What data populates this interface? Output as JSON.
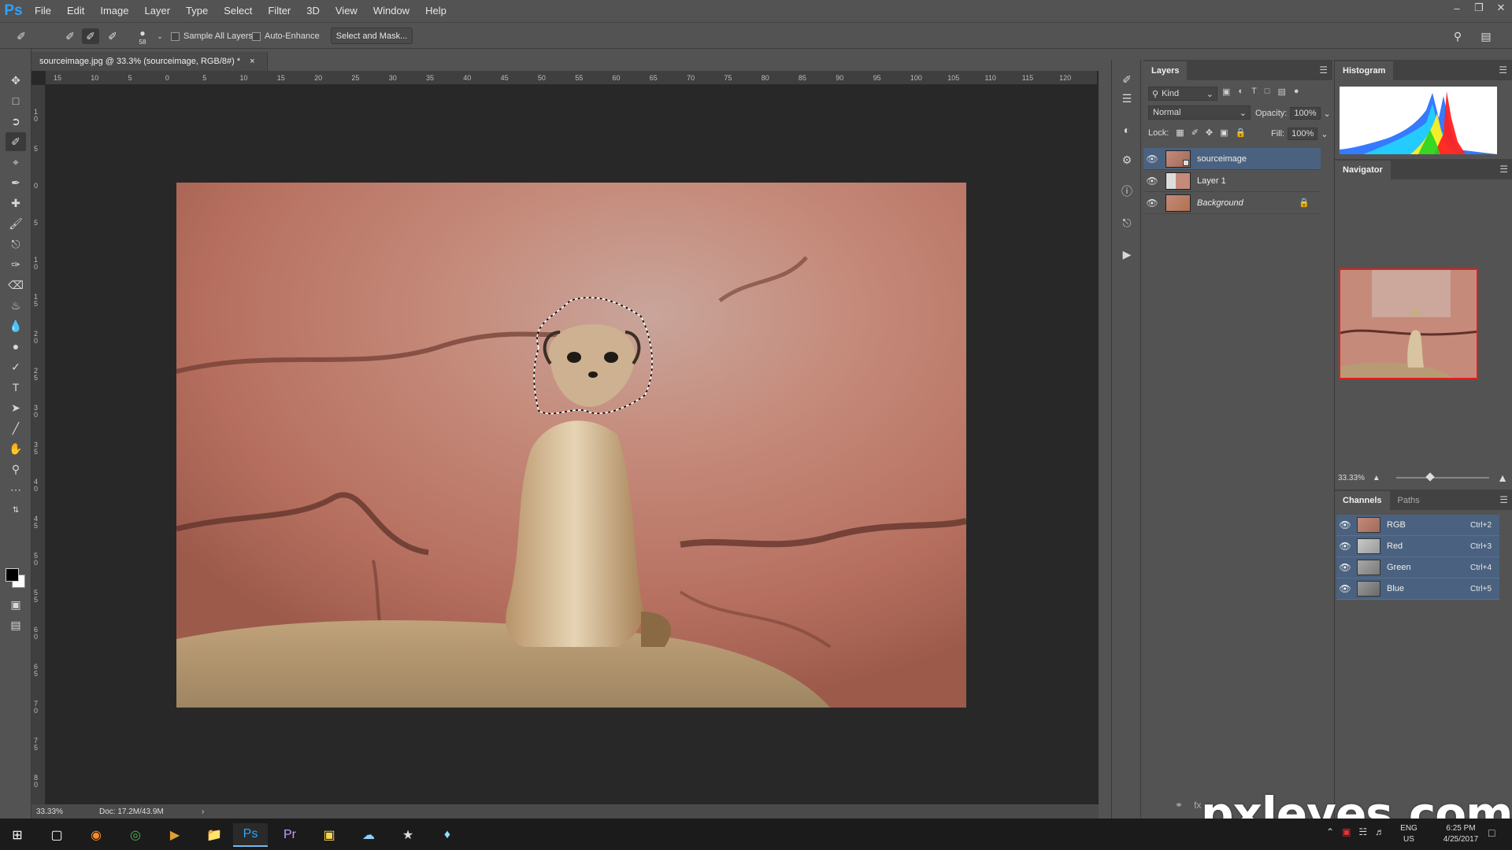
{
  "app": {
    "logo": "Ps"
  },
  "menu": [
    "File",
    "Edit",
    "Image",
    "Layer",
    "Type",
    "Select",
    "Filter",
    "3D",
    "View",
    "Window",
    "Help"
  ],
  "options": {
    "brush_size": "58",
    "sample_all_layers": "Sample All Layers",
    "auto_enhance": "Auto-Enhance",
    "select_and_mask": "Select and Mask..."
  },
  "document": {
    "tab_title": "sourceimage.jpg @ 33.3% (sourceimage, RGB/8#) *",
    "close_glyph": "×",
    "ruler_top": [
      "15",
      "10",
      "5",
      "0",
      "5",
      "10",
      "15",
      "20",
      "25",
      "30",
      "35",
      "40",
      "45",
      "50",
      "55",
      "60",
      "65",
      "70",
      "75",
      "80",
      "85",
      "90",
      "95",
      "100",
      "105",
      "110",
      "115",
      "120"
    ],
    "ruler_left": [
      "1\n0",
      "5",
      "0",
      "5",
      "1\n0",
      "1\n5",
      "2\n0",
      "2\n5",
      "3\n0",
      "3\n5",
      "4\n0",
      "4\n5",
      "5\n0",
      "5\n5",
      "6\n0",
      "6\n5",
      "7\n0",
      "7\n5",
      "8\n0"
    ]
  },
  "status": {
    "zoom": "33.33%",
    "doc": "Doc: 17.2M/43.9M"
  },
  "layers": {
    "tab": "Layers",
    "filter_kind": "Kind",
    "blend_mode": "Normal",
    "opacity_label": "Opacity:",
    "opacity_value": "100%",
    "lock_label": "Lock:",
    "fill_label": "Fill:",
    "fill_value": "100%",
    "items": [
      {
        "name": "sourceimage",
        "selected": true
      },
      {
        "name": "Layer 1",
        "selected": false
      },
      {
        "name": "Background",
        "selected": false
      }
    ]
  },
  "histogram": {
    "tab": "Histogram"
  },
  "navigator": {
    "tab": "Navigator",
    "zoom": "33.33%"
  },
  "channels": {
    "tabs": [
      "Channels",
      "Paths"
    ],
    "items": [
      {
        "name": "RGB",
        "shortcut": "Ctrl+2"
      },
      {
        "name": "Red",
        "shortcut": "Ctrl+3"
      },
      {
        "name": "Green",
        "shortcut": "Ctrl+4"
      },
      {
        "name": "Blue",
        "shortcut": "Ctrl+5"
      }
    ]
  },
  "taskbar": {
    "lang": "ENG",
    "region": "US",
    "time": "6:25 PM",
    "date": "4/25/2017"
  },
  "watermark": "pxleyes.com",
  "colors": {
    "accent": "#4a6280",
    "ps_blue": "#2fa3f6",
    "doc_bg": "#282828"
  }
}
